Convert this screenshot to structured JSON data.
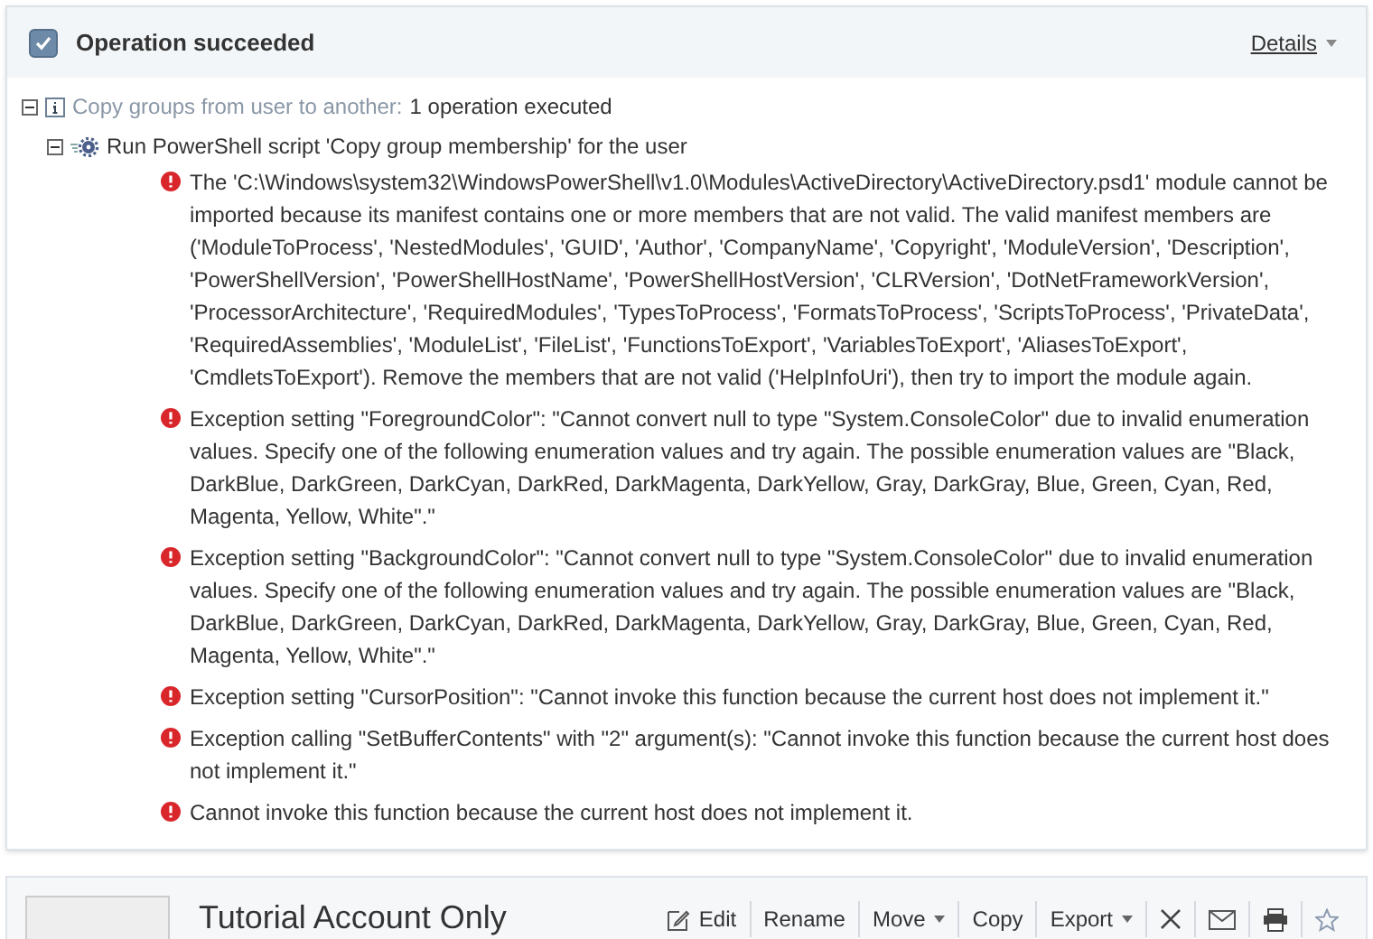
{
  "result": {
    "checked": true,
    "title": "Operation succeeded",
    "details_link": "Details"
  },
  "tree": [
    {
      "kind": "info",
      "label": "Copy groups from user to another:",
      "summary": "1 operation executed",
      "expanded": true,
      "children": [
        {
          "kind": "script",
          "label": "Run PowerShell script 'Copy group membership' for the user",
          "expanded": true,
          "errors": [
            "The 'C:\\Windows\\system32\\WindowsPowerShell\\v1.0\\Modules\\ActiveDirectory\\ActiveDirectory.psd1' module cannot be imported because its manifest contains one or more members that are not valid. The valid manifest members are ('ModuleToProcess', 'NestedModules', 'GUID', 'Author', 'CompanyName', 'Copyright', 'ModuleVersion', 'Description', 'PowerShellVersion', 'PowerShellHostName', 'PowerShellHostVersion', 'CLRVersion', 'DotNetFrameworkVersion', 'ProcessorArchitecture', 'RequiredModules', 'TypesToProcess', 'FormatsToProcess', 'ScriptsToProcess', 'PrivateData', 'RequiredAssemblies', 'ModuleList', 'FileList', 'FunctionsToExport', 'VariablesToExport', 'AliasesToExport', 'CmdletsToExport'). Remove the members that are not valid ('HelpInfoUri'), then try to import the module again.",
            "Exception setting \"ForegroundColor\": \"Cannot convert null to type \"System.ConsoleColor\" due to invalid enumeration values. Specify one of the following enumeration values and try again. The possible enumeration values are \"Black, DarkBlue, DarkGreen, DarkCyan, DarkRed, DarkMagenta, DarkYellow, Gray, DarkGray, Blue, Green, Cyan, Red, Magenta, Yellow, White\".\"",
            "Exception setting \"BackgroundColor\": \"Cannot convert null to type \"System.ConsoleColor\" due to invalid enumeration values. Specify one of the following enumeration values and try again. The possible enumeration values are \"Black, DarkBlue, DarkGreen, DarkCyan, DarkRed, DarkMagenta, DarkYellow, Gray, DarkGray, Blue, Green, Cyan, Red, Magenta, Yellow, White\".\"",
            "Exception setting \"CursorPosition\": \"Cannot invoke this function because the current host does not implement it.\"",
            "Exception calling \"SetBufferContents\" with \"2\" argument(s): \"Cannot invoke this function because the current host does not implement it.\"",
            "Cannot invoke this function because the current host does not implement it."
          ]
        }
      ]
    }
  ],
  "account": {
    "title": "Tutorial Account Only",
    "toolbar": [
      {
        "kind": "edit",
        "label": "Edit"
      },
      {
        "kind": "text",
        "label": "Rename"
      },
      {
        "kind": "dropdown",
        "label": "Move"
      },
      {
        "kind": "text",
        "label": "Copy"
      },
      {
        "kind": "dropdown",
        "label": "Export"
      },
      {
        "kind": "delete"
      },
      {
        "kind": "email"
      },
      {
        "kind": "print"
      },
      {
        "kind": "favorite"
      }
    ]
  }
}
